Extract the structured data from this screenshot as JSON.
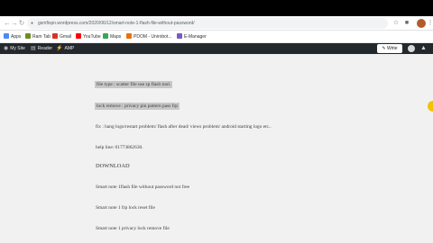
{
  "browser": {
    "url": "gsmfixpn.wordpress.com/2020/06/12/smart-note-1-flash-file-without-password/",
    "profile_color": "#b55a2b"
  },
  "bookmarks": [
    {
      "label": "Apps",
      "color": "#4a8af4"
    },
    {
      "label": "Ram Tab",
      "color": "#6b8e23"
    },
    {
      "label": "Gmail",
      "color": "#d93025"
    },
    {
      "label": "YouTube",
      "color": "#ff0000"
    },
    {
      "label": "Maps",
      "color": "#34a853"
    },
    {
      "label": "PDOM - Unirobot...",
      "color": "#e8710a"
    },
    {
      "label": "E-Manager",
      "color": "#7e57c2"
    }
  ],
  "admin_bar": {
    "my_site": "My Site",
    "reader": "Reader",
    "amp": "AMP",
    "write": "Write"
  },
  "content": {
    "file_type": "file type : scatter file use sp flash tool.",
    "lock_remove": "lock remove : privacy pin pattern pass frp",
    "fix": "fix : hang logo/restart problem/ flash after dead/ views problem/ android starting logo etc..",
    "help_line": "help line: 01773862630.",
    "download": "DOWNLOAD",
    "link1": "Smart note 1flash file without password not free",
    "link2": "Smart note 1 frp lock reset file",
    "link3": "Smart note 1 privacy lock remove file"
  },
  "colors": {
    "admin_bar": "#23282d",
    "page_bg": "#f1f1f1",
    "highlight": "#c8c8c8",
    "accent_bubble": "#f2c200"
  }
}
